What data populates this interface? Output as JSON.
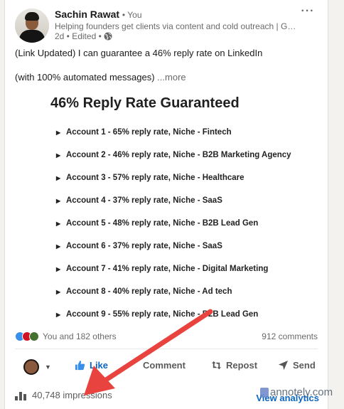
{
  "author": {
    "name": "Sachin Rawat",
    "relation": "• You",
    "headline": "Helping founders get clients via content and cold outreach | Growth...",
    "meta": "2d • Edited •"
  },
  "post": {
    "line1": "(Link Updated) I can guarantee a 46% reply rate on LinkedIn",
    "line2": "(with 100% automated messages)",
    "see_more": "...more"
  },
  "graphic": {
    "title": "46% Reply Rate Guaranteed",
    "items": [
      "Account 1 - 65% reply rate, Niche - Fintech",
      "Account 2 - 46% reply rate, Niche - B2B Marketing Agency",
      "Account 3 - 57% reply rate, Niche -  Healthcare",
      "Account 4 - 37% reply rate, Niche - SaaS",
      "Account 5 - 48% reply rate, Niche - B2B Lead Gen",
      "Account 6 - 37% reply rate, Niche - SaaS",
      "Account 7 - 41% reply rate, Niche - Digital Marketing",
      "Account 8 - 40% reply rate, Niche - Ad tech",
      "Account 9 - 55% reply rate, Niche - B2B Lead Gen"
    ]
  },
  "social": {
    "reactions_text": "You and 182 others",
    "comments": "912 comments"
  },
  "actions": {
    "like": "Like",
    "comment": "Comment",
    "repost": "Repost",
    "send": "Send"
  },
  "footer": {
    "impressions": "40,748 impressions",
    "view_analytics": "View analytics"
  },
  "watermark": "annotely.com",
  "colors": {
    "brand_blue": "#0a66c2",
    "annotation_arrow": "#e8433e"
  }
}
